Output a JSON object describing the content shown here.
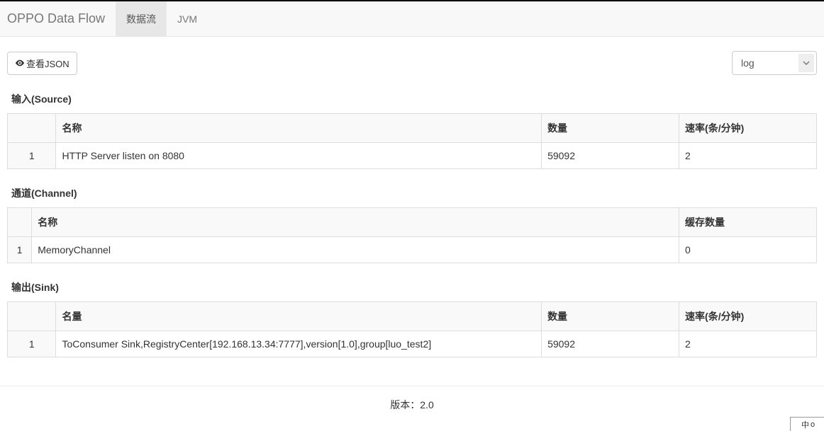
{
  "header": {
    "brand": "OPPO Data Flow",
    "tabs": [
      {
        "label": "数据流",
        "active": true
      },
      {
        "label": "JVM",
        "active": false
      }
    ]
  },
  "toolbar": {
    "view_json_label": "查看JSON",
    "select_value": "log"
  },
  "sections": {
    "source": {
      "title": "输入(Source)",
      "columns": {
        "name": "名称",
        "count": "数量",
        "rate": "速率(条/分钟)"
      },
      "rows": [
        {
          "idx": "1",
          "name": "HTTP Server listen on 8080",
          "count": "59092",
          "rate": "2"
        }
      ]
    },
    "channel": {
      "title": "通道(Channel)",
      "columns": {
        "name": "名称",
        "cache": "缓存数量"
      },
      "rows": [
        {
          "idx": "1",
          "name": "MemoryChannel",
          "cache": "0"
        }
      ]
    },
    "sink": {
      "title": "输出(Sink)",
      "columns": {
        "name": "名量",
        "count": "数量",
        "rate": "速率(条/分钟)"
      },
      "rows": [
        {
          "idx": "1",
          "name": "ToConsumer Sink,RegistryCenter[192.168.13.34:7777],version[1.0],group[luo_test2]",
          "count": "59092",
          "rate": "2"
        }
      ]
    }
  },
  "footer": {
    "version_text": "版本：2.0"
  },
  "ime": {
    "text": "中",
    "badge": "o"
  }
}
